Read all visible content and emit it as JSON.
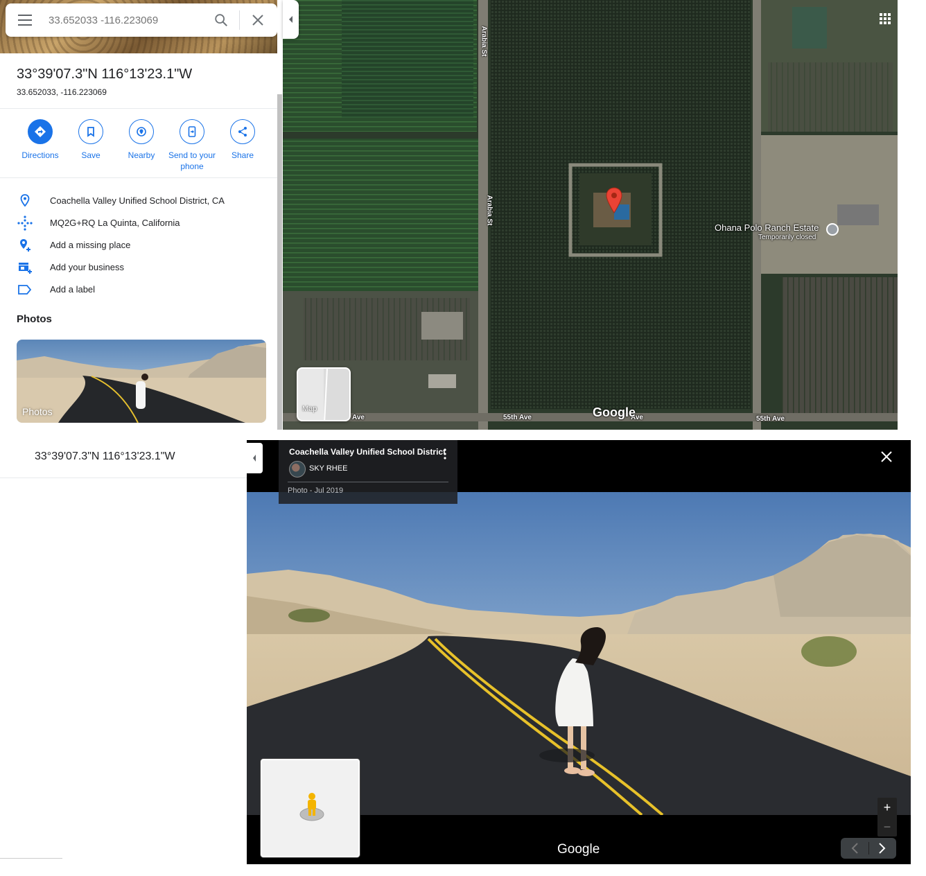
{
  "search": {
    "placeholder": "33.652033 -116.223069"
  },
  "place": {
    "title": "33°39'07.3\"N 116°13'23.1\"W",
    "decimal": "33.652033, -116.223069"
  },
  "actions": [
    {
      "label": "Directions",
      "icon": "directions-icon"
    },
    {
      "label": "Save",
      "icon": "bookmark-icon"
    },
    {
      "label": "Nearby",
      "icon": "nearby-icon"
    },
    {
      "label": "Send to your phone",
      "icon": "send-to-phone-icon"
    },
    {
      "label": "Share",
      "icon": "share-icon"
    }
  ],
  "info": [
    {
      "text": "Coachella Valley Unified School District, CA",
      "icon": "location-pin-icon"
    },
    {
      "text": "MQ2G+RQ La Quinta, California",
      "icon": "plus-code-icon"
    },
    {
      "text": "Add a missing place",
      "icon": "add-place-icon"
    },
    {
      "text": "Add your business",
      "icon": "add-business-icon"
    },
    {
      "text": "Add a label",
      "icon": "label-icon"
    }
  ],
  "photos": {
    "heading": "Photos",
    "card_label": "Photos"
  },
  "map": {
    "streets": [
      "Arabia St",
      "Arabia St",
      "Ave",
      "55th Ave",
      "Ave",
      "55th Ave"
    ],
    "poi_name": "Ohana Polo Ranch Estate",
    "poi_status": "Temporarily closed",
    "layer_toggle_label": "Map",
    "logo": "Google"
  },
  "viewer": {
    "left_coord": "33°39'07.3\"N 116°13'23.1\"W",
    "title": "Coachella Valley Unified School District",
    "author": "SKY RHEE",
    "date": "Photo - Jul 2019",
    "logo": "Google",
    "zoom_in": "+",
    "zoom_out": "−"
  },
  "colors": {
    "accent": "#1a73e8",
    "pin": "#ea4335"
  }
}
